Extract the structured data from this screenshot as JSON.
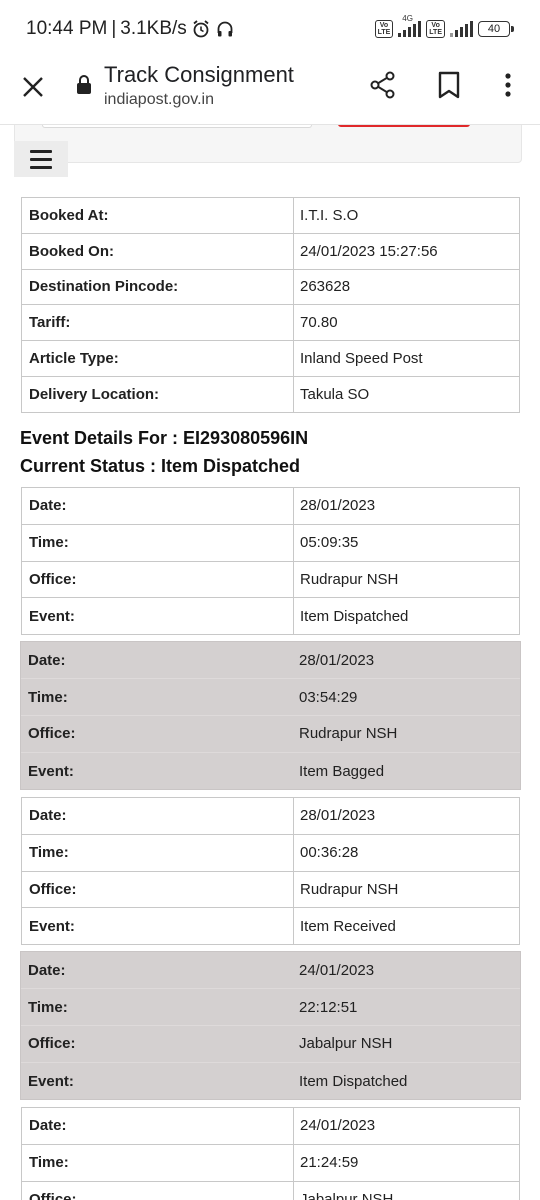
{
  "status_bar": {
    "time": "10:44 PM",
    "separator": "|",
    "speed": "3.1KB/s",
    "network_label": "4G",
    "volte_label": "Vo LTE",
    "battery": "40"
  },
  "browser": {
    "title": "Track Consignment",
    "url": "indiapost.gov.in"
  },
  "booking": [
    {
      "label": "Booked At:",
      "value": "I.T.I. S.O"
    },
    {
      "label": "Booked On:",
      "value": "24/01/2023 15:27:56"
    },
    {
      "label": "Destination Pincode:",
      "value": "263628"
    },
    {
      "label": "Tariff:",
      "value": "70.80"
    },
    {
      "label": "Article Type:",
      "value": "Inland Speed Post"
    },
    {
      "label": "Delivery Location:",
      "value": "Takula SO"
    }
  ],
  "event_details_heading": "Event Details For : EI293080596IN",
  "current_status": "Current Status : Item Dispatched",
  "field_labels": {
    "date": "Date:",
    "time": "Time:",
    "office": "Office:",
    "event": "Event:"
  },
  "events": [
    {
      "date": "28/01/2023",
      "time": "05:09:35",
      "office": "Rudrapur NSH",
      "event": "Item Dispatched"
    },
    {
      "date": "28/01/2023",
      "time": "03:54:29",
      "office": "Rudrapur NSH",
      "event": "Item Bagged"
    },
    {
      "date": "28/01/2023",
      "time": "00:36:28",
      "office": "Rudrapur NSH",
      "event": "Item Received"
    },
    {
      "date": "24/01/2023",
      "time": "22:12:51",
      "office": "Jabalpur NSH",
      "event": "Item Dispatched"
    },
    {
      "date": "24/01/2023",
      "time": "21:24:59",
      "office": "Jabalpur NSH",
      "event": ""
    }
  ],
  "icons": {
    "status_left": [
      "alarm-icon",
      "headphones-icon"
    ],
    "status_right": [
      "volte-icon",
      "signal-icon",
      "battery-icon"
    ],
    "toolbar": [
      "close-icon",
      "lock-icon",
      "share-icon",
      "bookmark-icon",
      "more-vert-icon"
    ],
    "page": [
      "menu-icon"
    ]
  },
  "colors": {
    "accent_red": "#e0282a",
    "row_grey": "#d4d0d0",
    "border": "#c8c8c8"
  }
}
